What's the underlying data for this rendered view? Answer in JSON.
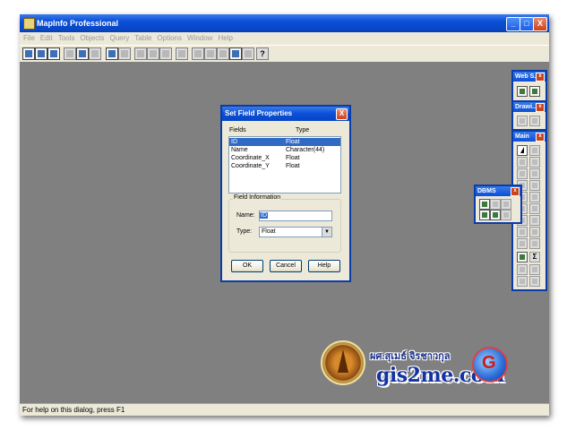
{
  "app": {
    "title": "MapInfo Professional",
    "window_buttons": {
      "minimize": "_",
      "maximize": "□",
      "close": "X"
    }
  },
  "menu": [
    "File",
    "Edit",
    "Tools",
    "Objects",
    "Query",
    "Table",
    "Options",
    "Window",
    "Help"
  ],
  "toolbar": {
    "help_glyph": "?"
  },
  "status": {
    "text": "For help on this dialog, press F1"
  },
  "dialog": {
    "title": "Set Field Properties",
    "close_glyph": "X",
    "col_fields": "Fields",
    "col_type": "Type",
    "fields": [
      {
        "name": "ID",
        "type": "Float",
        "selected": true
      },
      {
        "name": "Name",
        "type": "Character(44)",
        "selected": false
      },
      {
        "name": "Coordinate_X",
        "type": "Float",
        "selected": false
      },
      {
        "name": "Coordinate_Y",
        "type": "Float",
        "selected": false
      }
    ],
    "group_title": "Field Information",
    "name_label": "Name:",
    "name_value": "ID",
    "type_label": "Type:",
    "type_value": "Float",
    "dropdown_glyph": "▼",
    "ok_label": "OK",
    "cancel_label": "Cancel",
    "help_label": "Help"
  },
  "palettes": {
    "web": {
      "title": "Web S..."
    },
    "drawing": {
      "title": "Drawi..."
    },
    "main": {
      "title": "Main",
      "sigma": "Σ"
    },
    "dbms": {
      "title": "DBMS"
    },
    "close_glyph": "x"
  },
  "watermark": {
    "thai_name": "ผศ.สุเมธ์ จิรชาวกุล",
    "site": "gis2me.com"
  }
}
